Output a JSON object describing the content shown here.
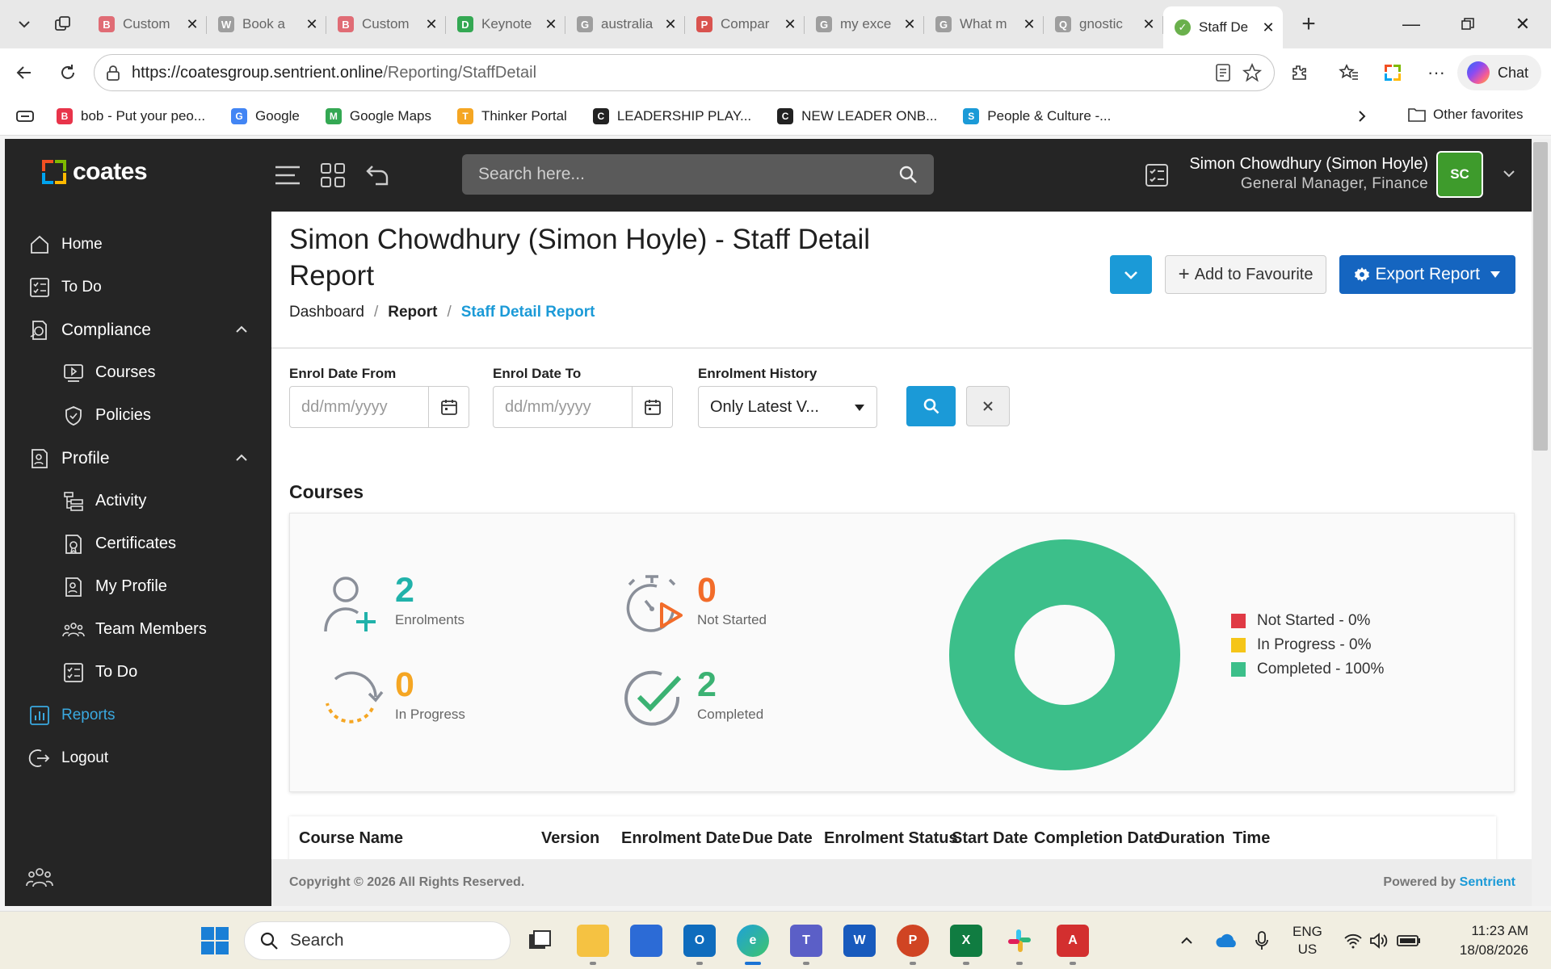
{
  "browser": {
    "tabs": [
      {
        "label": "Custom",
        "favicon": "B",
        "color": "#e06c75"
      },
      {
        "label": "Book a",
        "favicon": "W",
        "color": "#9e9e9e"
      },
      {
        "label": "Custom",
        "favicon": "B",
        "color": "#e06c75"
      },
      {
        "label": "Keynote",
        "favicon": "D",
        "color": "#34a853"
      },
      {
        "label": "australia",
        "favicon": "G",
        "color": "#9e9e9e"
      },
      {
        "label": "Compar",
        "favicon": "P",
        "color": "#d9534f"
      },
      {
        "label": "my exce",
        "favicon": "G",
        "color": "#9e9e9e"
      },
      {
        "label": "What m",
        "favicon": "G",
        "color": "#9e9e9e"
      },
      {
        "label": "gnostic",
        "favicon": "Q",
        "color": "#9e9e9e"
      }
    ],
    "active_tab": {
      "label": "Staff De"
    },
    "url_host": "https://coatesgroup.sentrient.online",
    "url_path": "/Reporting/StaffDetail",
    "chat_label": "Chat",
    "favorites": [
      {
        "label": "bob - Put your peo...",
        "icon": "B",
        "color": "#e8344a"
      },
      {
        "label": "Google",
        "icon": "G",
        "color": "#4285f4"
      },
      {
        "label": "Google Maps",
        "icon": "M",
        "color": "#34a853"
      },
      {
        "label": "Thinker Portal",
        "icon": "T",
        "color": "#f5a623"
      },
      {
        "label": "LEADERSHIP PLAY...",
        "icon": "C",
        "color": "#222222"
      },
      {
        "label": "NEW LEADER ONB...",
        "icon": "C",
        "color": "#222222"
      },
      {
        "label": "People & Culture -...",
        "icon": "S",
        "color": "#1b9ad7"
      }
    ],
    "other_favorites": "Other favorites"
  },
  "app": {
    "logo_text": "coates",
    "search_placeholder": "Search here...",
    "user_name": "Simon Chowdhury (Simon Hoyle)",
    "user_role": "General Manager, Finance",
    "user_initials": "SC",
    "menu": {
      "home": "Home",
      "todo": "To Do",
      "compliance": "Compliance",
      "courses": "Courses",
      "policies": "Policies",
      "profile": "Profile",
      "activity": "Activity",
      "certificates": "Certificates",
      "my_profile": "My Profile",
      "team_members": "Team Members",
      "todo_sub": "To Do",
      "reports": "Reports",
      "logout": "Logout"
    }
  },
  "page": {
    "title": "Simon Chowdhury (Simon Hoyle) - Staff Detail Report",
    "breadcrumb": [
      "Dashboard",
      "Report",
      "Staff Detail Report"
    ],
    "add_favourite": "Add to Favourite",
    "export_report": "Export Report",
    "filters": {
      "enrol_from_label": "Enrol Date From",
      "enrol_from_placeholder": "dd/mm/yyyy",
      "enrol_to_label": "Enrol Date To",
      "enrol_to_placeholder": "dd/mm/yyyy",
      "history_label": "Enrolment History",
      "history_value": "Only Latest V..."
    },
    "courses_title": "Courses",
    "stats": {
      "enrolments": {
        "value": "2",
        "label": "Enrolments",
        "color": "#20b2aa"
      },
      "not_started": {
        "value": "0",
        "label": "Not Started",
        "color": "#f26c2a"
      },
      "in_progress": {
        "value": "0",
        "label": "In Progress",
        "color": "#f5a623"
      },
      "completed": {
        "value": "2",
        "label": "Completed",
        "color": "#3bb273"
      }
    },
    "table_headers": [
      "Course Name",
      "Version",
      "Enrolment Date",
      "Due Date",
      "Enrolment Status",
      "Start Date",
      "Completion Date",
      "Duration",
      "Time"
    ],
    "footer_left": "Copyright © 2026 All Rights Reserved.",
    "footer_powered": "Powered by",
    "footer_brand": "Sentrient"
  },
  "chart_data": {
    "type": "pie",
    "categories": [
      "Not Started - 0%",
      "In Progress - 0%",
      "Completed - 100%"
    ],
    "values": [
      0,
      0,
      100
    ],
    "colors": [
      "#e03a45",
      "#f5c518",
      "#3cbf8a"
    ],
    "legend_position": "right"
  },
  "taskbar": {
    "search_label": "Search",
    "lang_top": "ENG",
    "lang_bottom": "US",
    "time": "11:23 AM",
    "date": "18/08/2026"
  }
}
